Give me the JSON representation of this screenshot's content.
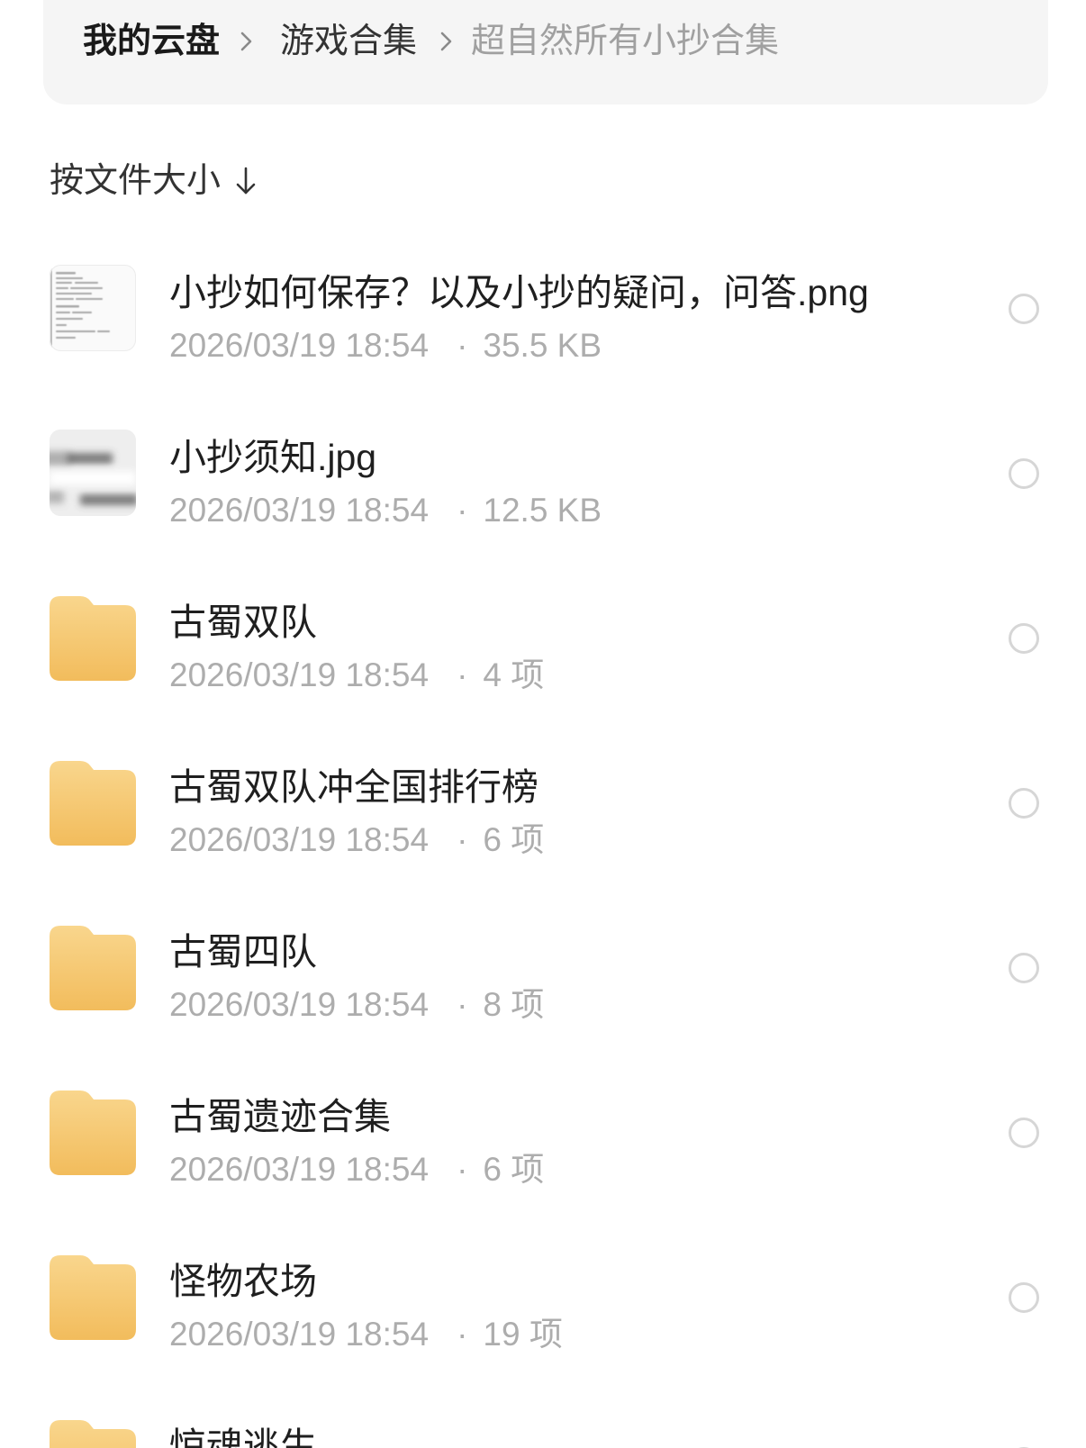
{
  "breadcrumb": {
    "items": [
      {
        "label": "我的云盘"
      },
      {
        "label": "游戏合集"
      },
      {
        "label": "超自然所有小抄合集"
      }
    ],
    "separator_icon": "chevron-right-icon"
  },
  "sort": {
    "label": "按文件大小",
    "direction_icon": "arrow-down-icon"
  },
  "file_list": {
    "meta_separator": "·"
  },
  "files": [
    {
      "name": "小抄如何保存？以及小抄的疑问，问答.png",
      "modified": "2026/03/19 18:54",
      "detail": "35.5 KB",
      "icon": "image-thumbnail"
    },
    {
      "name": "小抄须知.jpg",
      "modified": "2026/03/19 18:54",
      "detail": "12.5 KB",
      "icon": "image-thumbnail"
    },
    {
      "name": "古蜀双队",
      "modified": "2026/03/19 18:54",
      "detail": "4 项",
      "icon": "folder-icon"
    },
    {
      "name": "古蜀双队冲全国排行榜",
      "modified": "2026/03/19 18:54",
      "detail": "6 项",
      "icon": "folder-icon"
    },
    {
      "name": "古蜀四队",
      "modified": "2026/03/19 18:54",
      "detail": "8 项",
      "icon": "folder-icon"
    },
    {
      "name": "古蜀遗迹合集",
      "modified": "2026/03/19 18:54",
      "detail": "6 项",
      "icon": "folder-icon"
    },
    {
      "name": "怪物农场",
      "modified": "2026/03/19 18:54",
      "detail": "19 项",
      "icon": "folder-icon"
    },
    {
      "name": "惊魂逃生",
      "icon": "folder-icon"
    }
  ],
  "colors": {
    "breadcrumb_background": "#f5f5f5",
    "folder_top": "#f9d68d",
    "folder_bottom": "#f2bc5c",
    "text_primary": "#1f1f1f",
    "text_secondary": "#adadad",
    "radio_border": "#d6d6d6"
  }
}
